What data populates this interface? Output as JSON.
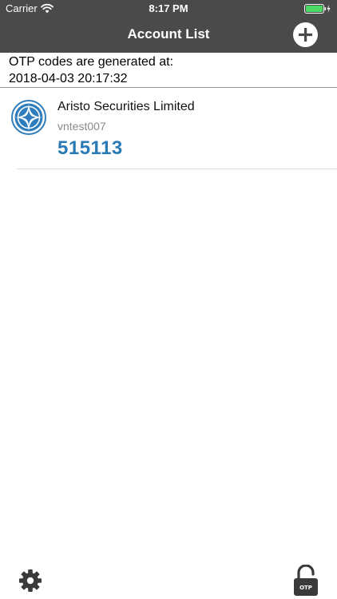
{
  "status_bar": {
    "carrier": "Carrier",
    "time": "8:17 PM",
    "icons": [
      "wifi-icon",
      "battery-icon",
      "charging-bolt-icon"
    ]
  },
  "nav": {
    "title": "Account List",
    "add_icon": "plus-icon"
  },
  "info": {
    "line1": "OTP codes are generated at:",
    "line2": "2018-04-03 20:17:32"
  },
  "accounts": [
    {
      "name": "Aristo Securities Limited",
      "username": "vntest007",
      "otp_code": "515113",
      "logo_icon": "aristo-logo-icon"
    }
  ],
  "toolbar": {
    "settings_icon": "gear-icon",
    "otp_lock_label": "OTP",
    "otp_lock_icon": "padlock-icon"
  },
  "colors": {
    "header_bg": "#4a4a4a",
    "otp_code": "#2a7ab5",
    "logo_blue": "#2f7dbd",
    "toolbar_icon": "#3a3a3a",
    "battery_green": "#4cd964"
  }
}
